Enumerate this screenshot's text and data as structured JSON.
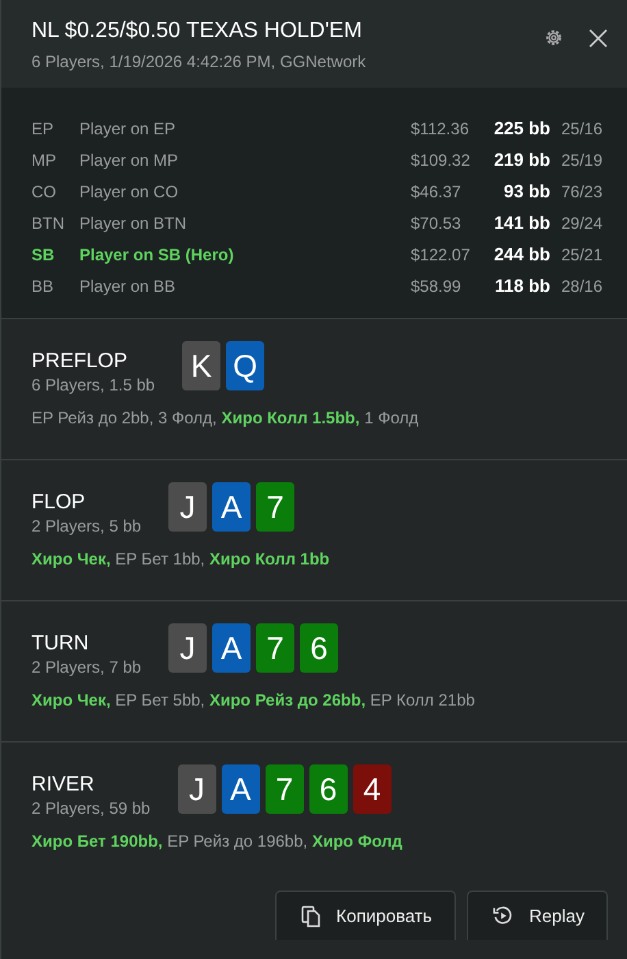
{
  "header": {
    "title": "NL $0.25/$0.50 TEXAS HOLD'EM",
    "subtitle": "6 Players, 1/19/2026 4:42:26 PM, GGNetwork"
  },
  "players": [
    {
      "position": "EP",
      "name": "Player on EP",
      "stack": "$112.36",
      "bb": "225 bb",
      "stat": "25/16",
      "hero": false
    },
    {
      "position": "MP",
      "name": "Player on MP",
      "stack": "$109.32",
      "bb": "219 bb",
      "stat": "25/19",
      "hero": false
    },
    {
      "position": "CO",
      "name": "Player on CO",
      "stack": "$46.37",
      "bb": "93 bb",
      "stat": "76/23",
      "hero": false
    },
    {
      "position": "BTN",
      "name": "Player on BTN",
      "stack": "$70.53",
      "bb": "141 bb",
      "stat": "29/24",
      "hero": false
    },
    {
      "position": "SB",
      "name": "Player on SB (Hero)",
      "stack": "$122.07",
      "bb": "244 bb",
      "stat": "25/21",
      "hero": true
    },
    {
      "position": "BB",
      "name": "Player on BB",
      "stack": "$58.99",
      "bb": "118 bb",
      "stat": "28/16",
      "hero": false
    }
  ],
  "streets": [
    {
      "name": "PREFLOP",
      "info": "6 Players, 1.5 bb",
      "cards": [
        {
          "rank": "K",
          "color": "#4d4d4d"
        },
        {
          "rank": "Q",
          "color": "#0a5fb4"
        }
      ],
      "actions": "EP Рейз до 2bb, 3 Фолд, **Хиро Колл 1.5bb,** 1 Фолд"
    },
    {
      "name": "FLOP",
      "info": "2 Players, 5 bb",
      "cards": [
        {
          "rank": "J",
          "color": "#4d4d4d"
        },
        {
          "rank": "A",
          "color": "#0a5fb4"
        },
        {
          "rank": "7",
          "color": "#0a7d0a"
        }
      ],
      "actions": "**Хиро Чек,** EP Бет 1bb, **Хиро Колл 1bb**"
    },
    {
      "name": "TURN",
      "info": "2 Players, 7 bb",
      "cards": [
        {
          "rank": "J",
          "color": "#4d4d4d"
        },
        {
          "rank": "A",
          "color": "#0a5fb4"
        },
        {
          "rank": "7",
          "color": "#0a7d0a"
        },
        {
          "rank": "6",
          "color": "#0a7d0a"
        }
      ],
      "actions": "**Хиро Чек,** EP Бет 5bb, **Хиро Рейз до 26bb,** EP Колл 21bb"
    },
    {
      "name": "RIVER",
      "info": "2 Players, 59 bb",
      "cards": [
        {
          "rank": "J",
          "color": "#4d4d4d"
        },
        {
          "rank": "A",
          "color": "#0a5fb4"
        },
        {
          "rank": "7",
          "color": "#0a7d0a"
        },
        {
          "rank": "6",
          "color": "#0a7d0a"
        },
        {
          "rank": "4",
          "color": "#7d0f0a"
        }
      ],
      "actions": "**Хиро Бет 190bb,** EP Рейз до 196bb, **Хиро Фолд**"
    }
  ],
  "buttons": [
    {
      "kind": "copy",
      "label": "Копировать"
    },
    {
      "kind": "replay",
      "label": "Replay"
    }
  ]
}
